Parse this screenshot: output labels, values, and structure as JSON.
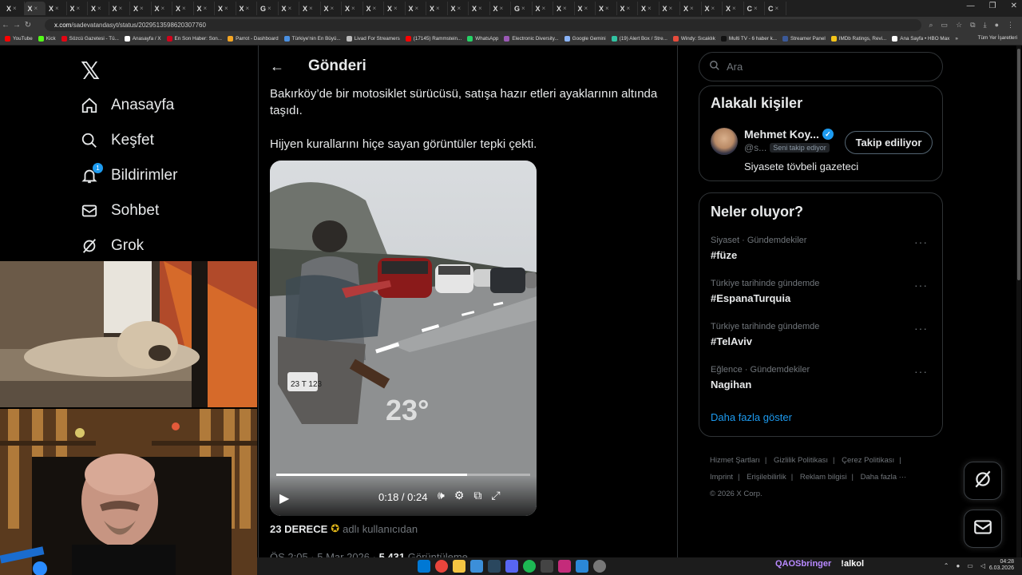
{
  "browser": {
    "tabs": [
      "X",
      "X",
      "X",
      "X",
      "X",
      "X",
      "X",
      "X",
      "X",
      "X",
      "X",
      "X",
      "G",
      "X",
      "X",
      "X",
      "X",
      "X",
      "X",
      "X",
      "X",
      "X",
      "X",
      "X",
      "G",
      "X",
      "X",
      "X",
      "X",
      "X",
      "X",
      "X",
      "X",
      "X",
      "X",
      "C",
      "C"
    ],
    "url_host": "x.com",
    "url_path": "/sadevatandasyt/status/2029513598620307760",
    "bookmarks": [
      {
        "label": "YouTube",
        "color": "#ff0000"
      },
      {
        "label": "Kick",
        "color": "#53fc18"
      },
      {
        "label": "Sözcü Gazetesi - Tü...",
        "color": "#e30613"
      },
      {
        "label": "Anasayfa / X",
        "color": "#ffffff"
      },
      {
        "label": "En Son Haber: Son...",
        "color": "#d0021b"
      },
      {
        "label": "Parrot - Dashboard",
        "color": "#f5a623"
      },
      {
        "label": "Türkiye'nin En Büyü...",
        "color": "#4a90e2"
      },
      {
        "label": "Livad For Streamers",
        "color": "#bbbbbb"
      },
      {
        "label": "(17145) Rammstein...",
        "color": "#ff0000"
      },
      {
        "label": "WhatsApp",
        "color": "#25d366"
      },
      {
        "label": "Electronic Diversity...",
        "color": "#9b59b6"
      },
      {
        "label": "Google Gemini",
        "color": "#8ab4f8"
      },
      {
        "label": "(19) Alert Box / Stre...",
        "color": "#31c3a2"
      },
      {
        "label": "Windy: Sıcaklık",
        "color": "#e74c3c"
      },
      {
        "label": "Multi TV - 6 haber k...",
        "color": "#111111"
      },
      {
        "label": "Streamer Panel",
        "color": "#3b5998"
      },
      {
        "label": "IMDb Ratings, Revi...",
        "color": "#f5c518"
      },
      {
        "label": "Ana Sayfa • HBO Max",
        "color": "#ffffff"
      }
    ],
    "bookmarks_more": "»",
    "all_bookmarks": "Tüm Yer İşaretleri"
  },
  "nav": {
    "logo": "𝕏",
    "items": [
      {
        "label": "Anasayfa",
        "icon": "home-icon"
      },
      {
        "label": "Keşfet",
        "icon": "search-icon"
      },
      {
        "label": "Bildirimler",
        "icon": "bell-icon",
        "badge": "1"
      },
      {
        "label": "Sohbet",
        "icon": "mail-icon"
      },
      {
        "label": "Grok",
        "icon": "grok-icon"
      }
    ]
  },
  "post": {
    "header_title": "Gönderi",
    "text_1": "Bakırköy’de bir motosiklet sürücüsü, satışa hazır etleri ayaklarının altında taşıdı.",
    "text_2": "Hijyen kurallarını hiçe sayan görüntüler tepki çekti.",
    "video": {
      "time": "0:18 / 0:24",
      "progress": 0.75,
      "watermark": "23°",
      "plate": "23 T 123"
    },
    "source_name": "23 DERECE",
    "source_suffix": "adlı kullanıcıdan",
    "meta_time": "ÖS 2:05 · 5 Mar 2026 ·",
    "meta_views_count": "5.431",
    "meta_views_label": "Görüntüleme"
  },
  "sidebar": {
    "search_placeholder": "Ara",
    "relevant_title": "Alakalı kişiler",
    "person": {
      "name": "Mehmet Koy...",
      "handle": "@s...",
      "follows_you": "Seni takip ediyor",
      "follow_button": "Takip ediliyor",
      "bio": "Siyasete tövbeli gazeteci"
    },
    "trends_title": "Neler oluyor?",
    "trends": [
      {
        "category": "Siyaset · Gündemdekiler",
        "name": "#füze"
      },
      {
        "category": "Türkiye tarihinde gündemde",
        "name": "#EspanaTurquia"
      },
      {
        "category": "Türkiye tarihinde gündemde",
        "name": "#TelAviv"
      },
      {
        "category": "Eğlence · Gündemdekiler",
        "name": "Nagihan"
      }
    ],
    "show_more": "Daha fazla göster",
    "footer": {
      "links": [
        "Hizmet Şartları",
        "|",
        "Gizlilik Politikası",
        "|",
        "Çerez Politikası",
        "|",
        "Imprint",
        "|",
        "Erişilebilirlik",
        "|",
        "Reklam bilgisi",
        "|",
        "Daha fazla ···"
      ],
      "copyright": "© 2026 X Corp."
    }
  },
  "stream_overlay": {
    "user": "QAOSbringer",
    "message": "!alkol"
  },
  "clock": {
    "time": "04:28",
    "date": "6.03.2026"
  }
}
